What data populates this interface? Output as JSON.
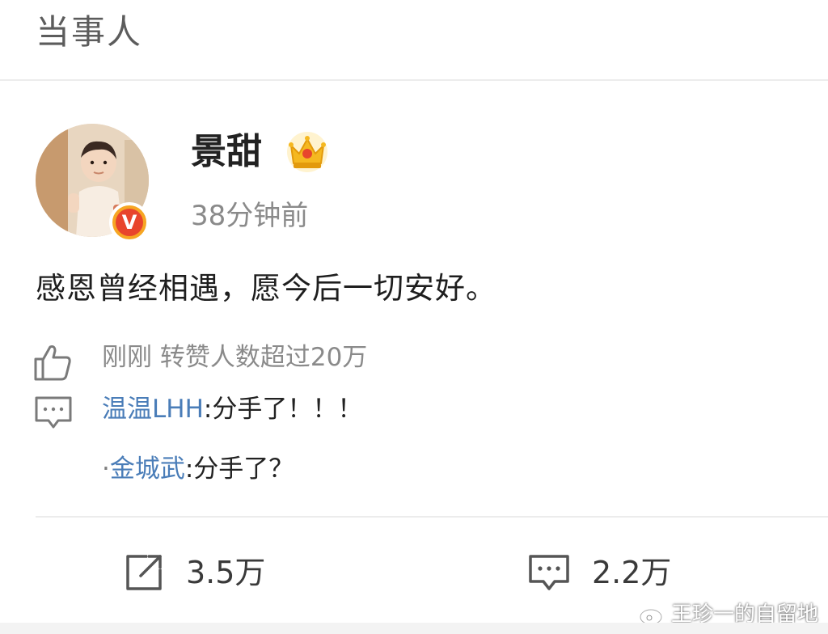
{
  "header": {
    "title": "当事人"
  },
  "post": {
    "username": "景甜",
    "time": "38分钟前",
    "text": "感恩曾经相遇，愿今后一切安好。",
    "verified_badge": "V",
    "likes_text": "刚刚 转赞人数超过20万",
    "comments": [
      {
        "prefix": "",
        "user": "温温LHH",
        "text": ":分手了！！！"
      },
      {
        "prefix": "·",
        "user": "金城武",
        "text": ":分手了？"
      }
    ]
  },
  "actions": {
    "repost_count": "3.5万",
    "comment_count": "2.2万"
  },
  "watermark": {
    "text": "王珍一的自留地"
  },
  "icons": {
    "crown": "crown-icon",
    "verified": "verified-badge-icon",
    "like": "thumbs-up-icon",
    "comment": "comment-bubble-icon",
    "repost": "repost-icon",
    "weibo": "weibo-logo-icon"
  },
  "colors": {
    "username_link": "#4a7db8",
    "secondary_text": "#8a8a8a",
    "badge_orange": "#f6a623",
    "badge_red": "#e8452c",
    "crown_gold": "#f5b820"
  }
}
